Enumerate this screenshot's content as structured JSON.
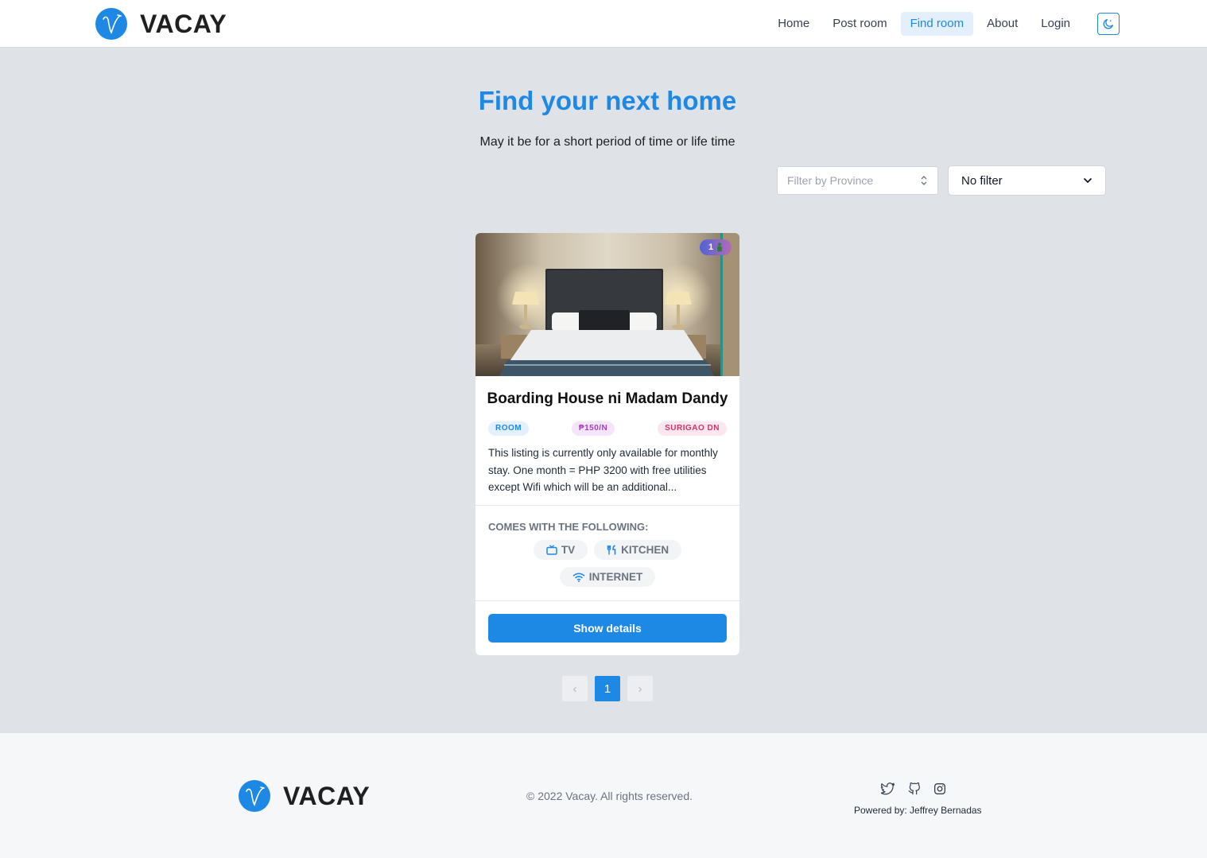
{
  "nav": {
    "brand": "VACAY",
    "links": [
      "Home",
      "Post room",
      "Find room",
      "About",
      "Login"
    ],
    "active_link": "Find room",
    "theme_toggle_icon": "moon-icon"
  },
  "hero": {
    "title": "Find your next home",
    "subtitle": "May it be for a short period of time or life time"
  },
  "filters": {
    "province_placeholder": "Filter by Province",
    "select_value": "No filter"
  },
  "listing": {
    "occupancy": "1",
    "occupancy_icon": "person-icon",
    "title": "Boarding House ni Madam Dandy",
    "type": "ROOM",
    "price": "₱150/N",
    "location": "SURIGAO DN",
    "description": "This listing is currently only available for monthly stay. One month = PHP 3200 with free utilities except Wifi which will be an additional...",
    "amenities_title": "COMES WITH THE FOLLOWING:",
    "amenities": [
      {
        "label": "TV",
        "icon": "tv-icon"
      },
      {
        "label": "KITCHEN",
        "icon": "utensils-icon"
      },
      {
        "label": "INTERNET",
        "icon": "wifi-icon"
      }
    ],
    "action": "Show details"
  },
  "pagination": {
    "prev": "‹",
    "current": "1",
    "next": "›"
  },
  "footer": {
    "brand": "VACAY",
    "copyright": "© 2022 Vacay. All rights reserved.",
    "socials": [
      "twitter-icon",
      "github-icon",
      "instagram-icon"
    ],
    "powered": "Powered by: Jeffrey Bernadas"
  },
  "colors": {
    "accent": "#1e88e5",
    "page_bg": "#dfe2e7",
    "footer_bg": "#f6f7f9"
  }
}
